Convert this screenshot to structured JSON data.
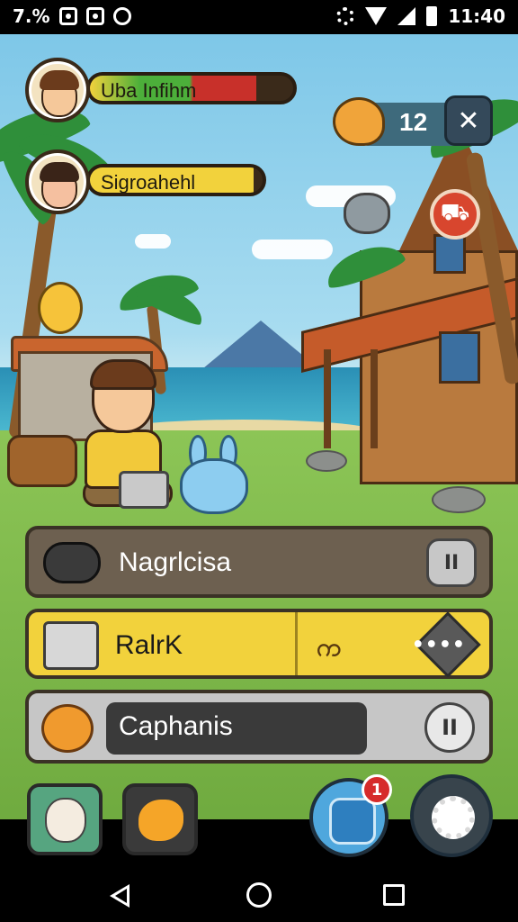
{
  "status_bar": {
    "left_text": "7.%",
    "time": "11:40"
  },
  "hud": {
    "player1_name": "Uba Infihm",
    "player1_health_fraction": 0.82,
    "player2_name": "Sigroahehl",
    "player2_progress_fraction": 0.95,
    "coin_count": "12"
  },
  "menu": {
    "play_label": "Nagrlcisa",
    "play_button_glyph": "II",
    "rank_label": "RalrK",
    "rank_mid_glyph": " က",
    "rank_more_glyph": "••••",
    "capture_label": "Caphanis",
    "capture_button_glyph": "II"
  },
  "dock": {
    "notification_count": "1"
  },
  "colors": {
    "health_green": "#4caf3a",
    "health_red": "#c8302a",
    "progress_yellow": "#f2d23c",
    "panel_yellow": "#f2d23c",
    "badge_red": "#d62b2b"
  }
}
